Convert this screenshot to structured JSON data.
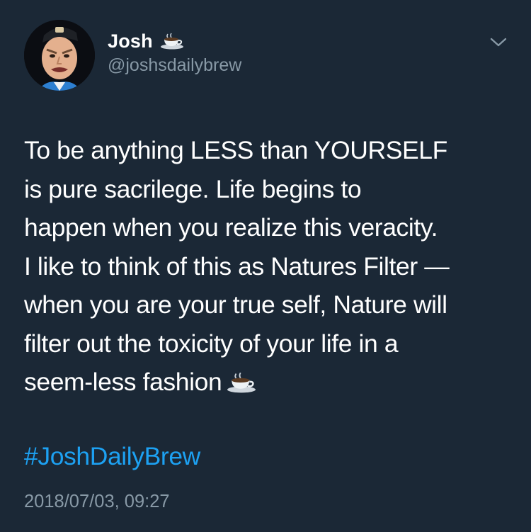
{
  "tweet": {
    "author": {
      "display_name": "Josh",
      "handle": "@joshsdailybrew",
      "name_emoji": "coffee-cup-icon"
    },
    "text": "To be anything LESS than YOURSELF\nis pure sacrilege. Life begins to\nhappen when you realize this veracity.\nI like to think of this as Natures Filter —\nwhen you are your true self, Nature will\nfilter out the toxicity of your life in a\nseem-less fashion",
    "text_trailing_emoji": "coffee-cup-icon",
    "hashtag": "#JoshDailyBrew",
    "timestamp": "2018/07/03, 09:27"
  },
  "colors": {
    "background": "#1b2836",
    "text": "#ffffff",
    "secondary_text": "#8899a6",
    "link": "#1da1f2"
  }
}
